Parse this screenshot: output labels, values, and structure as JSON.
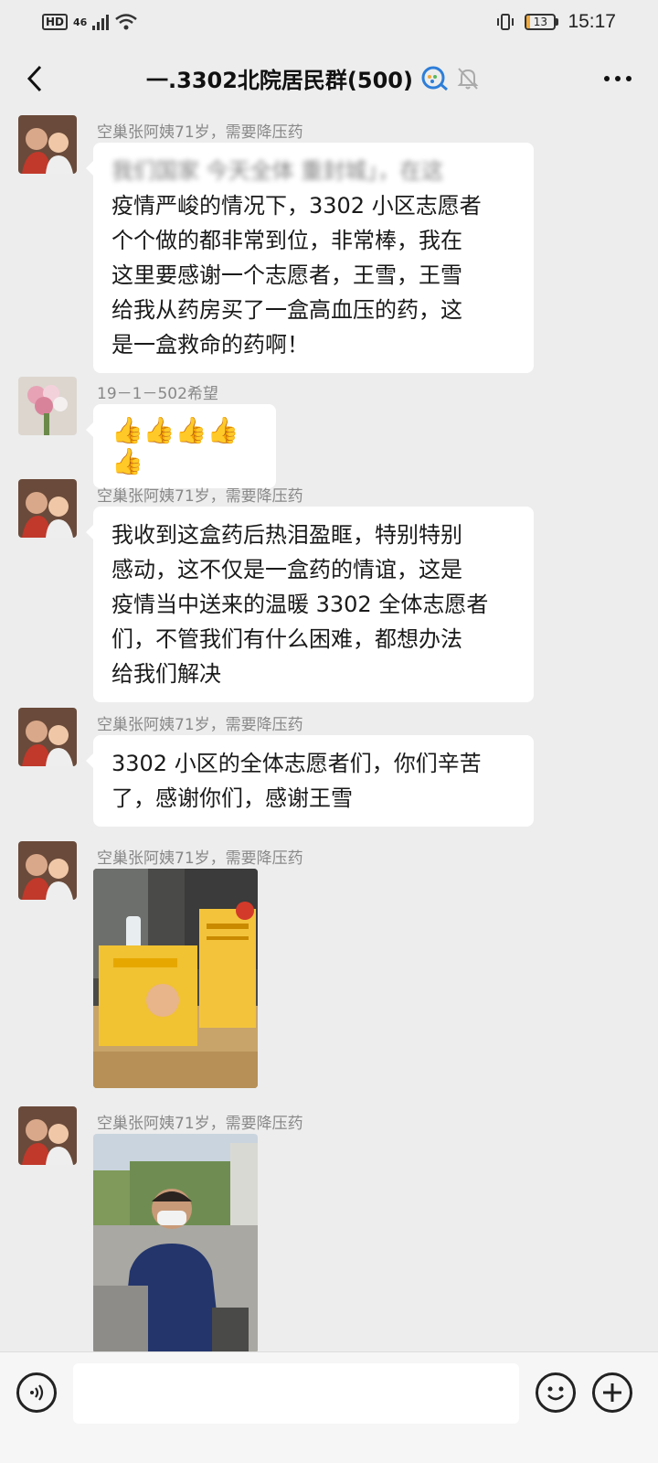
{
  "status_bar": {
    "hd": "HD",
    "network": "46",
    "battery_level": "13",
    "battery_fraction": 0.13,
    "time": "15:17"
  },
  "header": {
    "title": "一.3302北院居民群(500)",
    "icons": [
      "back-chevron-icon",
      "group-badge-icon",
      "mute-bell-icon",
      "more-dots-icon"
    ]
  },
  "messages": [
    {
      "sender": "空巢张阿姨71岁，需要降压药",
      "partial_first_line": "我们国家 今天全体 重封城」，在这",
      "text_lines": [
        "疫情严峻的情况下，3302 小区志愿者",
        "个个做的都非常到位，非常棒，我在",
        "这里要感谢一个志愿者，王雪，王雪",
        "给我从药房买了一盒高血压的药，这",
        "是一盒救命的药啊！"
      ]
    },
    {
      "sender": "19－1－502希望",
      "text": "👍👍👍👍👍"
    },
    {
      "sender": "空巢张阿姨71岁，需要降压药",
      "text_lines": [
        "我收到这盒药后热泪盈眶，特别特别",
        "感动，这不仅是一盒药的情谊，这是",
        "疫情当中送来的温暖 3302 全体志愿者",
        "们，不管我们有什么困难，都想办法",
        "给我们解决"
      ]
    },
    {
      "sender": "空巢张阿姨71岁，需要降压药",
      "text_lines": [
        "3302 小区的全体志愿者们，你们辛苦",
        "了，感谢你们，感谢王雪"
      ]
    },
    {
      "sender": "空巢张阿姨71岁，需要降压药",
      "image": "medicine-boxes-photo"
    },
    {
      "sender": "空巢张阿姨71岁，需要降压药",
      "image": "volunteer-photo"
    }
  ],
  "input_bar": {
    "icons": [
      "voice-icon",
      "emoji-icon",
      "plus-icon"
    ]
  }
}
